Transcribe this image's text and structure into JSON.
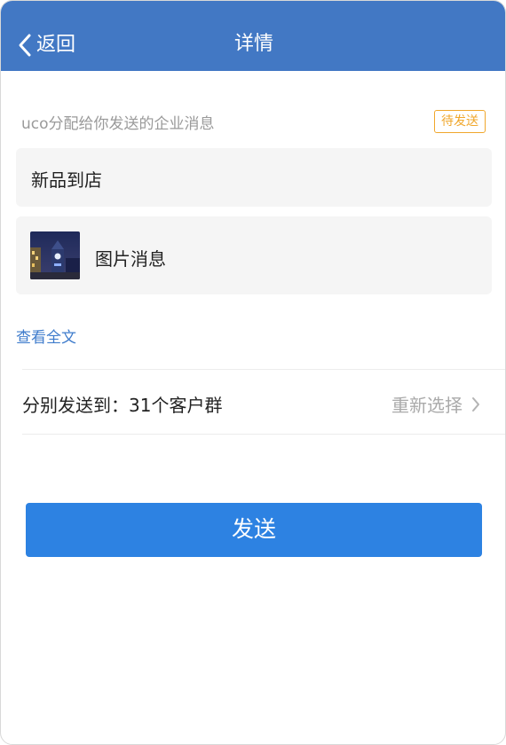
{
  "navbar": {
    "back_label": "返回",
    "title": "详情",
    "background": "#4278c4"
  },
  "message": {
    "sender_line": "uco分配给你发送的企业消息",
    "status_badge": "待发送",
    "title": "新品到店",
    "attachment_label": "图片消息",
    "view_full_link": "查看全文"
  },
  "recipients": {
    "label": "分别发送到：31个客户群",
    "reselect_label": "重新选择"
  },
  "actions": {
    "send_label": "发送",
    "send_color": "#2d82e2"
  },
  "icons": {
    "back": "chevron-left-icon",
    "reselect": "chevron-right-icon"
  }
}
